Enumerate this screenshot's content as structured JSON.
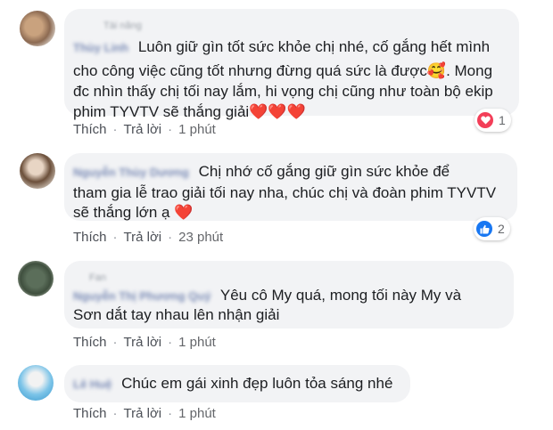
{
  "comments": [
    {
      "group_tag": "Tài năng",
      "author": "Thùy Linh",
      "text_line1": "Luôn giữ gìn tốt sức khỏe chị nhé, cố gắng hết mình",
      "text_line2": "cho công việc cũng tốt nhưng đừng quá sức là được🥰. Mong",
      "text_line3": "đc nhìn thấy chị tối nay lắm, hi vọng chị cũng như toàn bộ ekip",
      "text_line4": "phim TYVTV sẽ thắng giải❤️❤️❤️",
      "like_label": "Thích",
      "reply_label": "Trả lời",
      "time": "1 phút",
      "reaction_icon": "heart-icon",
      "reaction_count": "1"
    },
    {
      "author": "Nguyễn Thùy Dương",
      "text_line1": "Chị nhớ cố gắng giữ gìn sức khỏe để",
      "text_line2": "tham gia lễ trao giải tối nay nha, chúc chị và đoàn phim TYVTV",
      "text_line3": "sẽ thắng lớn ạ ❤️",
      "like_label": "Thích",
      "reply_label": "Trả lời",
      "time": "23 phút",
      "reaction_icon": "thumbs-up-icon",
      "reaction_count": "2"
    },
    {
      "group_tag": "Fan",
      "author": "Nguyễn Thị Phương Quý",
      "text_line1": "Yêu cô My quá, mong tối này My và",
      "text_line2": "Sơn dắt tay nhau lên nhận giải",
      "like_label": "Thích",
      "reply_label": "Trả lời",
      "time": "1 phút"
    },
    {
      "author": "Lê Huệ",
      "text_line1": "Chúc em gái xinh đẹp luôn tỏa sáng nhé",
      "like_label": "Thích",
      "reply_label": "Trả lời",
      "time": "1 phút"
    }
  ],
  "colors": {
    "bubble": "#f2f3f5",
    "like_blue": "#1877f2",
    "heart_red": "#f33e58"
  }
}
